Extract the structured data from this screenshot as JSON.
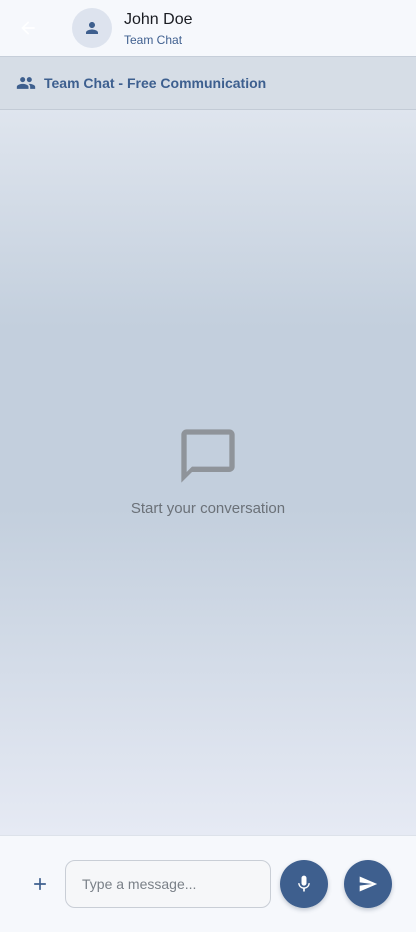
{
  "header": {
    "contact_name": "John Doe",
    "contact_subtitle": "Team Chat",
    "back_icon": "arrow-left-icon",
    "avatar_icon": "person-icon"
  },
  "banner": {
    "icon": "group-icon",
    "text": "Team Chat - Free Communication"
  },
  "empty_state": {
    "icon": "chat-bubble-outline-icon",
    "text": "Start your conversation"
  },
  "composer": {
    "attach_icon": "plus-icon",
    "placeholder": "Type a message...",
    "value": "",
    "mic_icon": "mic-icon",
    "send_icon": "send-icon"
  },
  "colors": {
    "accent": "#3e5f8e",
    "header_bg": "#f6f8fc",
    "banner_bg": "#d6dde6"
  }
}
